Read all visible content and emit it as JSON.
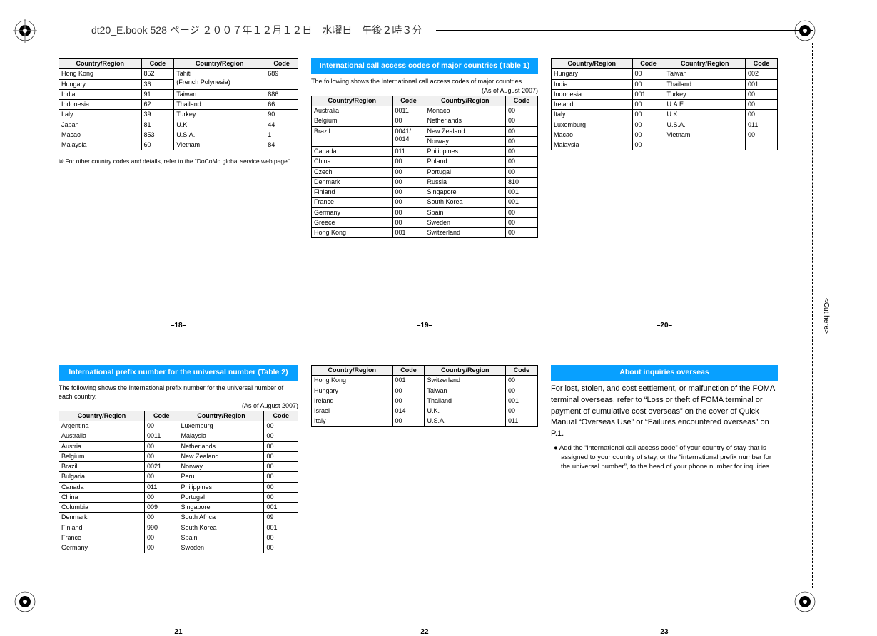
{
  "print_header": "dt20_E.book  528 ページ  ２００７年１２月１２日　水曜日　午後２時３分",
  "cut_label": "<Cut here>",
  "panel18": {
    "footer": "–18–",
    "headers": [
      "Country/Region",
      "Code",
      "Country/Region",
      "Code"
    ],
    "rows": [
      [
        "Hong Kong",
        "852",
        "Tahiti\n(French Polynesia)",
        "689"
      ],
      [
        "Hungary",
        "36",
        "",
        ""
      ],
      [
        "India",
        "91",
        "Taiwan",
        "886"
      ],
      [
        "Indonesia",
        "62",
        "Thailand",
        "66"
      ],
      [
        "Italy",
        "39",
        "Turkey",
        "90"
      ],
      [
        "Japan",
        "81",
        "U.K.",
        "44"
      ],
      [
        "Macao",
        "853",
        "U.S.A.",
        "1"
      ],
      [
        "Malaysia",
        "60",
        "Vietnam",
        "84"
      ]
    ],
    "footnote": "※ For other country codes and details, refer to the “DoCoMo global service web page”."
  },
  "panel19": {
    "footer": "–19–",
    "title": "International call access codes of major countries (Table 1)",
    "desc": "The following shows the International call access codes of major countries.",
    "asof": "(As of August 2007)",
    "headers": [
      "Country/Region",
      "Code",
      "Country/Region",
      "Code"
    ],
    "rows": [
      [
        "Australia",
        "0011",
        "Monaco",
        "00"
      ],
      [
        "Belgium",
        "00",
        "Netherlands",
        "00"
      ],
      [
        "Brazil",
        "0041/\n0014",
        "New Zealand",
        "00"
      ],
      [
        "",
        "",
        "Norway",
        "00"
      ],
      [
        "Canada",
        "011",
        "Philippines",
        "00"
      ],
      [
        "China",
        "00",
        "Poland",
        "00"
      ],
      [
        "Czech",
        "00",
        "Portugal",
        "00"
      ],
      [
        "Denmark",
        "00",
        "Russia",
        "810"
      ],
      [
        "Finland",
        "00",
        "Singapore",
        "001"
      ],
      [
        "France",
        "00",
        "South Korea",
        "001"
      ],
      [
        "Germany",
        "00",
        "Spain",
        "00"
      ],
      [
        "Greece",
        "00",
        "Sweden",
        "00"
      ],
      [
        "Hong Kong",
        "001",
        "Switzerland",
        "00"
      ]
    ]
  },
  "panel20": {
    "footer": "–20–",
    "headers": [
      "Country/Region",
      "Code",
      "Country/Region",
      "Code"
    ],
    "rows": [
      [
        "Hungary",
        "00",
        "Taiwan",
        "002"
      ],
      [
        "India",
        "00",
        "Thailand",
        "001"
      ],
      [
        "Indonesia",
        "001",
        "Turkey",
        "00"
      ],
      [
        "Ireland",
        "00",
        "U.A.E.",
        "00"
      ],
      [
        "Italy",
        "00",
        "U.K.",
        "00"
      ],
      [
        "Luxemburg",
        "00",
        "U.S.A.",
        "011"
      ],
      [
        "Macao",
        "00",
        "Vietnam",
        "00"
      ],
      [
        "Malaysia",
        "00",
        "",
        ""
      ]
    ]
  },
  "panel21": {
    "footer": "–21–",
    "title": "International prefix number for the universal number (Table 2)",
    "desc": "The following shows the International prefix number for the universal number of each country.",
    "asof": "(As of August 2007)",
    "headers": [
      "Country/Region",
      "Code",
      "Country/Region",
      "Code"
    ],
    "rows": [
      [
        "Argentina",
        "00",
        "Luxemburg",
        "00"
      ],
      [
        "Australia",
        "0011",
        "Malaysia",
        "00"
      ],
      [
        "Austria",
        "00",
        "Netherlands",
        "00"
      ],
      [
        "Belgium",
        "00",
        "New Zealand",
        "00"
      ],
      [
        "Brazil",
        "0021",
        "Norway",
        "00"
      ],
      [
        "Bulgaria",
        "00",
        "Peru",
        "00"
      ],
      [
        "Canada",
        "011",
        "Philippines",
        "00"
      ],
      [
        "China",
        "00",
        "Portugal",
        "00"
      ],
      [
        "Columbia",
        "009",
        "Singapore",
        "001"
      ],
      [
        "Denmark",
        "00",
        "South Africa",
        "09"
      ],
      [
        "Finland",
        "990",
        "South Korea",
        "001"
      ],
      [
        "France",
        "00",
        "Spain",
        "00"
      ],
      [
        "Germany",
        "00",
        "Sweden",
        "00"
      ]
    ]
  },
  "panel22": {
    "footer": "–22–",
    "headers": [
      "Country/Region",
      "Code",
      "Country/Region",
      "Code"
    ],
    "rows": [
      [
        "Hong Kong",
        "001",
        "Switzerland",
        "00"
      ],
      [
        "Hungary",
        "00",
        "Taiwan",
        "00"
      ],
      [
        "Ireland",
        "00",
        "Thailand",
        "001"
      ],
      [
        "Israel",
        "014",
        "U.K.",
        "00"
      ],
      [
        "Italy",
        "00",
        "U.S.A.",
        "011"
      ]
    ]
  },
  "panel23": {
    "footer": "–23–",
    "title": "About inquiries overseas",
    "body": "For lost, stolen, and cost settlement, or malfunction of the FOMA terminal overseas, refer to “Loss or theft of FOMA terminal or payment of cumulative cost overseas” on the cover of Quick Manual “Overseas Use” or “Failures encountered overseas” on P.1.",
    "bullet": "● Add the “international call access code” of your country of stay that is assigned to your country of stay, or the “international prefix number for the universal number”, to the head of your phone number for inquiries."
  }
}
